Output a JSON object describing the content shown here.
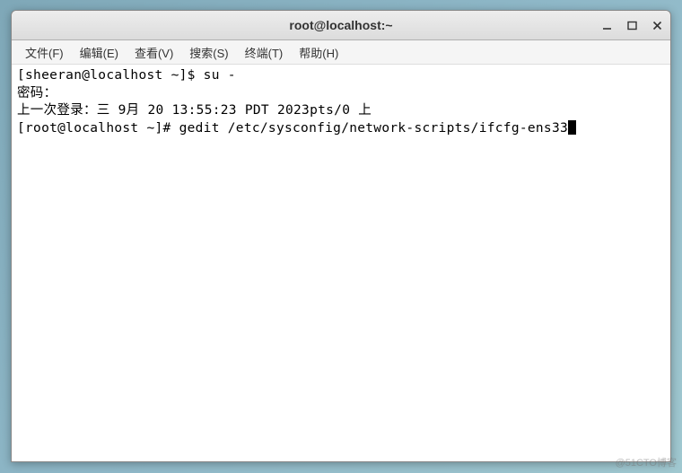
{
  "titlebar": {
    "title": "root@localhost:~"
  },
  "menubar": {
    "items": [
      "文件(F)",
      "编辑(E)",
      "查看(V)",
      "搜索(S)",
      "终端(T)",
      "帮助(H)"
    ]
  },
  "terminal": {
    "lines": [
      "[sheeran@localhost ~]$ su -",
      "密码：",
      "上一次登录：三 9月 20 13:55:23 PDT 2023pts/0 上",
      "[root@localhost ~]# gedit /etc/sysconfig/network-scripts/ifcfg-ens33"
    ]
  },
  "watermark": "@51CTO博客"
}
